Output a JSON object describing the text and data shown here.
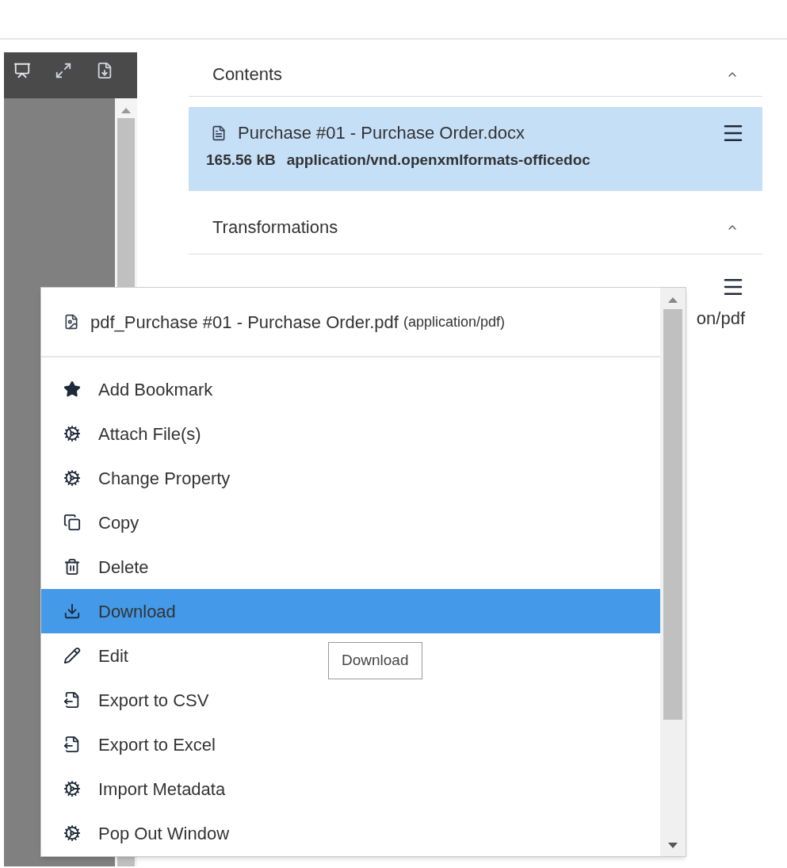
{
  "sections": [
    {
      "title": "Contents",
      "expanded": true
    },
    {
      "title": "Transformations",
      "expanded": true
    }
  ],
  "content_item": {
    "name": "Purchase #01 - Purchase Order.docx",
    "size": "165.56 kB",
    "mime": "application/vnd.openxmlformats-officedoc",
    "selected": true
  },
  "transformation_item": {
    "visible_text": "on/pdf"
  },
  "context_menu": {
    "file_name": "pdf_Purchase #01 - Purchase Order.pdf",
    "file_type": "(application/pdf)",
    "items": [
      {
        "label": "Add Bookmark",
        "selected": false
      },
      {
        "label": "Attach File(s)",
        "selected": false
      },
      {
        "label": "Change Property",
        "selected": false
      },
      {
        "label": "Copy",
        "selected": false
      },
      {
        "label": "Delete",
        "selected": false
      },
      {
        "label": "Download",
        "selected": true
      },
      {
        "label": "Edit",
        "selected": false
      },
      {
        "label": "Export to CSV",
        "selected": false
      },
      {
        "label": "Export to Excel",
        "selected": false
      },
      {
        "label": "Import Metadata",
        "selected": false
      },
      {
        "label": "Pop Out Window",
        "selected": false
      }
    ]
  },
  "tooltip": "Download"
}
